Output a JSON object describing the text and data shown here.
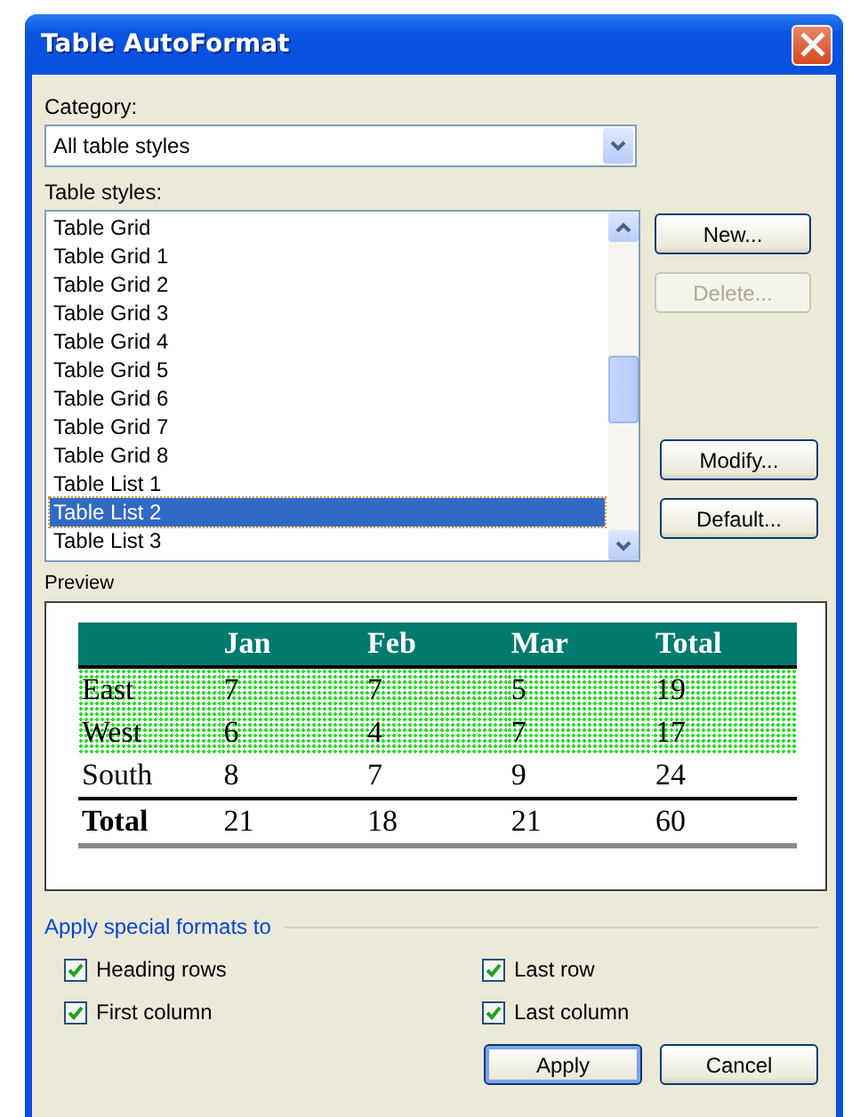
{
  "window": {
    "title": "Table AutoFormat"
  },
  "category": {
    "label": "Category:",
    "value": "All table styles"
  },
  "table_styles": {
    "label": "Table styles:",
    "items": [
      {
        "label": "Table Grid",
        "selected": false
      },
      {
        "label": "Table Grid 1",
        "selected": false
      },
      {
        "label": "Table Grid 2",
        "selected": false
      },
      {
        "label": "Table Grid 3",
        "selected": false
      },
      {
        "label": "Table Grid 4",
        "selected": false
      },
      {
        "label": "Table Grid 5",
        "selected": false
      },
      {
        "label": "Table Grid 6",
        "selected": false
      },
      {
        "label": "Table Grid 7",
        "selected": false
      },
      {
        "label": "Table Grid 8",
        "selected": false
      },
      {
        "label": "Table List 1",
        "selected": false
      },
      {
        "label": "Table List 2",
        "selected": true
      },
      {
        "label": "Table List 3",
        "selected": false
      }
    ]
  },
  "side_buttons": [
    {
      "label": "New...",
      "disabled": false
    },
    {
      "label": "Delete...",
      "disabled": true
    },
    {
      "label": "Modify...",
      "disabled": false
    },
    {
      "label": "Default...",
      "disabled": false
    }
  ],
  "preview": {
    "label": "Preview",
    "columns": [
      "",
      "Jan",
      "Feb",
      "Mar",
      "Total"
    ],
    "rows": [
      {
        "kind": "body",
        "shaded": true,
        "cells": [
          "East",
          "7",
          "7",
          "5",
          "19"
        ]
      },
      {
        "kind": "body",
        "shaded": true,
        "cells": [
          "West",
          "6",
          "4",
          "7",
          "17"
        ]
      },
      {
        "kind": "body",
        "shaded": false,
        "cells": [
          "South",
          "8",
          "7",
          "9",
          "24"
        ]
      },
      {
        "kind": "total",
        "shaded": false,
        "cells": [
          "Total",
          "21",
          "18",
          "21",
          "60"
        ]
      }
    ]
  },
  "special_formats": {
    "label": "Apply special formats to",
    "options": [
      {
        "label": "Heading rows",
        "checked": true
      },
      {
        "label": "Last row",
        "checked": true
      },
      {
        "label": "First column",
        "checked": true
      },
      {
        "label": "Last column",
        "checked": true
      }
    ]
  },
  "buttons": [
    {
      "label": "Apply",
      "default": true
    },
    {
      "label": "Cancel",
      "default": false
    }
  ]
}
